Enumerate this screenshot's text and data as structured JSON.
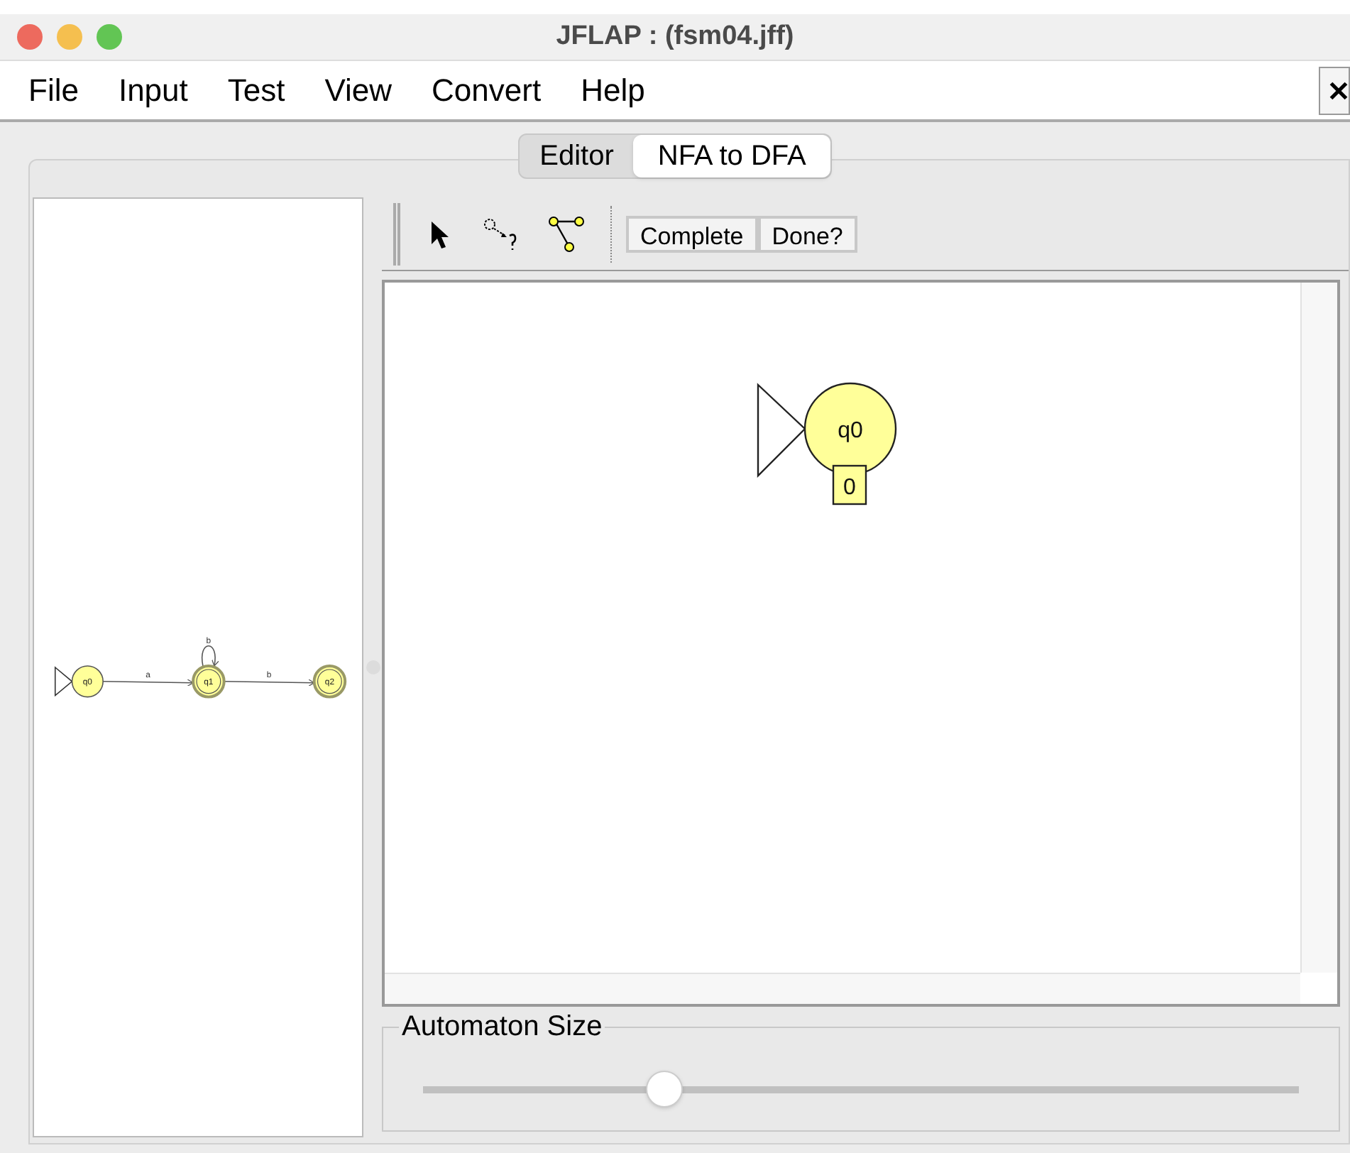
{
  "window": {
    "title": "JFLAP : (fsm04.jff)"
  },
  "menu": [
    "File",
    "Input",
    "Test",
    "View",
    "Convert",
    "Help"
  ],
  "tabs": [
    {
      "label": "Editor",
      "selected": false
    },
    {
      "label": "NFA to DFA",
      "selected": true
    }
  ],
  "toolbar_buttons": [
    "Complete",
    "Done?"
  ],
  "nfa": {
    "states": [
      {
        "label": "q0",
        "initial": true,
        "final": false
      },
      {
        "label": "q1",
        "initial": false,
        "final": true
      },
      {
        "label": "q2",
        "initial": false,
        "final": true
      }
    ],
    "transitions": [
      {
        "label": "a",
        "kind": "line"
      },
      {
        "label": "b",
        "kind": "loop"
      },
      {
        "label": "b",
        "kind": "line"
      }
    ]
  },
  "dfa": {
    "states": [
      {
        "label": "q0",
        "initial": true,
        "subset": "0"
      }
    ]
  },
  "slider": {
    "label": "Automaton Size",
    "level": 0.275
  }
}
